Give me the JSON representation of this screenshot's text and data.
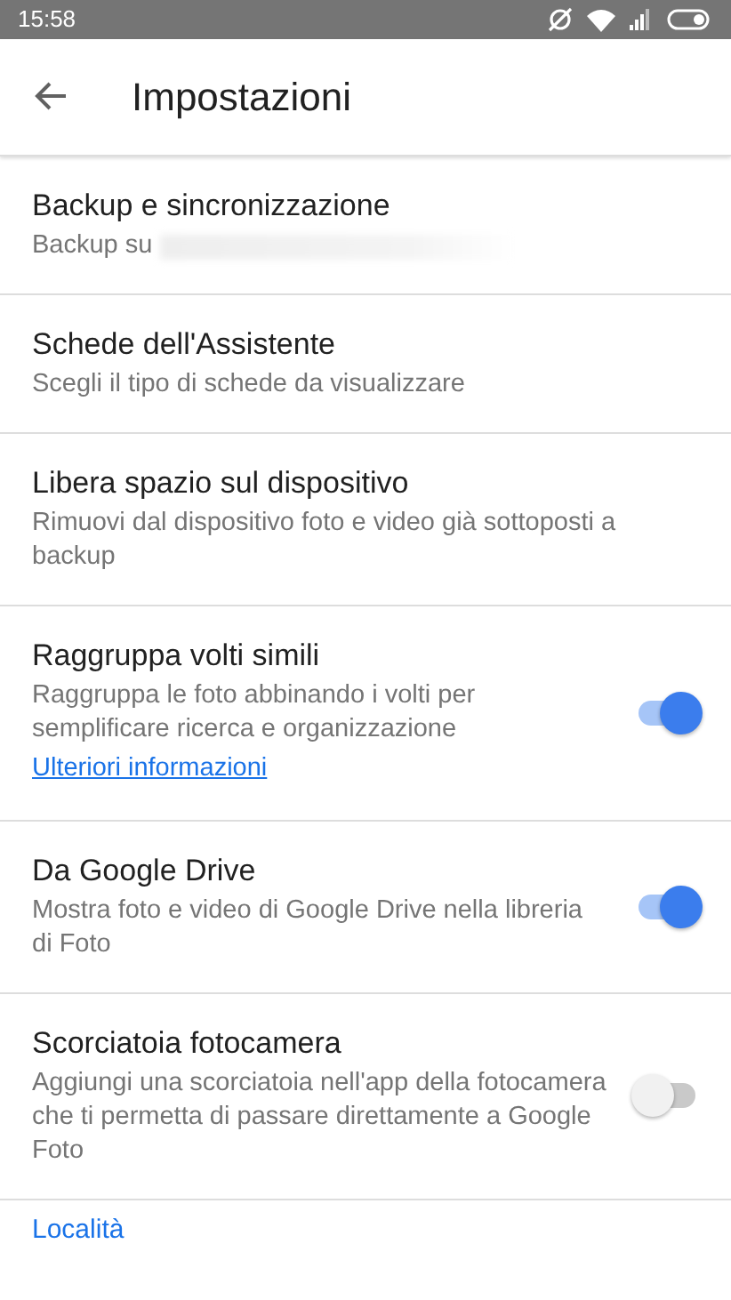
{
  "status_bar": {
    "time": "15:58"
  },
  "toolbar": {
    "title": "Impostazioni"
  },
  "settings": [
    {
      "kind": "plain",
      "title": "Backup e sincronizzazione",
      "subtitle": "Backup su",
      "redacted": true
    },
    {
      "kind": "plain",
      "title": "Schede dell'Assistente",
      "subtitle": "Scegli il tipo di schede da visualizzare"
    },
    {
      "kind": "plain",
      "title": "Libera spazio sul dispositivo",
      "subtitle": "Rimuovi dal dispositivo foto e video già sottoposti a backup"
    },
    {
      "kind": "toggle",
      "title": "Raggruppa volti simili",
      "subtitle": "Raggruppa le foto abbinando i volti per semplificare ricerca e organizzazione",
      "link": "Ulteriori informazioni",
      "on": true
    },
    {
      "kind": "toggle",
      "title": "Da Google Drive",
      "subtitle": "Mostra foto e video di Google Drive nella libreria di Foto",
      "on": true
    },
    {
      "kind": "toggle",
      "title": "Scorciatoia fotocamera",
      "subtitle": "Aggiungi una scorciatoia nell'app della fotocamera che ti permetta di passare direttamente a Google Foto",
      "on": false
    }
  ],
  "section_header": "Località"
}
